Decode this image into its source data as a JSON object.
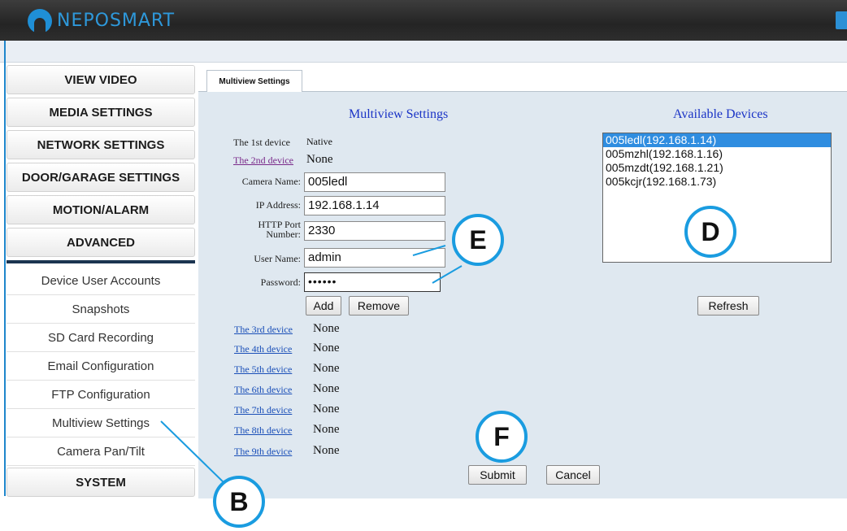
{
  "brand": "NEPOSMART",
  "sidebar": {
    "main_items": [
      "VIEW VIDEO",
      "MEDIA SETTINGS",
      "NETWORK SETTINGS",
      "DOOR/GARAGE SETTINGS",
      "MOTION/ALARM",
      "ADVANCED"
    ],
    "sub_items": [
      "Device User Accounts",
      "Snapshots",
      "SD Card Recording",
      "Email Configuration",
      "FTP Configuration",
      "Multiview Settings",
      "Camera Pan/Tilt"
    ],
    "system": "SYSTEM"
  },
  "tab": {
    "label": "Multiview Settings"
  },
  "multiview": {
    "title": "Multiview Settings",
    "first_device_label": "The 1st device",
    "first_device_value": "Native",
    "second_device_label": "The 2nd device",
    "second_device_value": "None",
    "camera_name_label": "Camera Name:",
    "camera_name_value": "005ledl",
    "ip_label": "IP Address:",
    "ip_value": "192.168.1.14",
    "http_port_label_1": "HTTP Port",
    "http_port_label_2": "Number:",
    "http_port_value": "2330",
    "user_name_label": "User Name:",
    "user_name_value": "admin",
    "password_label": "Password:",
    "password_value": "••••••",
    "add_label": "Add",
    "remove_label": "Remove",
    "devices": [
      {
        "label": "The 3rd device",
        "value": "None"
      },
      {
        "label": "The 4th device",
        "value": "None"
      },
      {
        "label": "The 5th device",
        "value": "None"
      },
      {
        "label": "The 6th device",
        "value": "None"
      },
      {
        "label": "The 7th device",
        "value": "None"
      },
      {
        "label": "The 8th device",
        "value": "None"
      },
      {
        "label": "The 9th device",
        "value": "None"
      }
    ],
    "submit_label": "Submit",
    "cancel_label": "Cancel"
  },
  "available": {
    "title": "Available Devices",
    "devices": [
      "005ledl(192.168.1.14)",
      "005mzhl(192.168.1.16)",
      "005mzdt(192.168.1.21)",
      "005kcjr(192.168.1.73)"
    ],
    "selected_index": 0,
    "refresh_label": "Refresh"
  },
  "callouts": {
    "b": "B",
    "d": "D",
    "e": "E",
    "f": "F"
  },
  "colors": {
    "accent": "#1a9ce0",
    "link": "#1a4fb8",
    "title_blue": "#1b34c6",
    "selected": "#2f8de0"
  }
}
